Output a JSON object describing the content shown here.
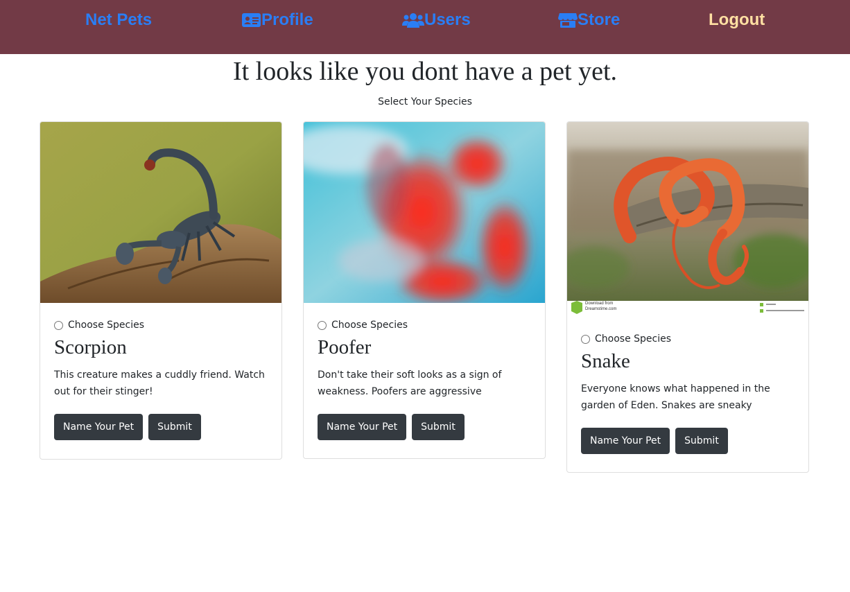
{
  "nav": {
    "brand": "Net Pets",
    "profile": "Profile",
    "users": "Users",
    "store": "Store",
    "logout": "Logout",
    "link_color": "#2a7ef5",
    "logout_color": "#ffe0a3",
    "background": "#723a46"
  },
  "heading": "It looks like you dont have a pet yet.",
  "subheading": "Select Your Species",
  "cards": [
    {
      "radio_label": "Choose Species",
      "title": "Scorpion",
      "description": "This creature makes a cuddly friend. Watch out for their stinger!",
      "name_button": "Name Your Pet",
      "submit_button": "Submit"
    },
    {
      "radio_label": "Choose Species",
      "title": "Poofer",
      "description": "Don't take their soft looks as a sign of weakness. Poofers are aggressive",
      "name_button": "Name Your Pet",
      "submit_button": "Submit"
    },
    {
      "radio_label": "Choose Species",
      "title": "Snake",
      "description": "Everyone knows what happened in the garden of Eden. Snakes are sneaky",
      "name_button": "Name Your Pet",
      "submit_button": "Submit",
      "watermark_text": "Download from Dreamstime.com"
    }
  ],
  "button_color": "#343a40"
}
